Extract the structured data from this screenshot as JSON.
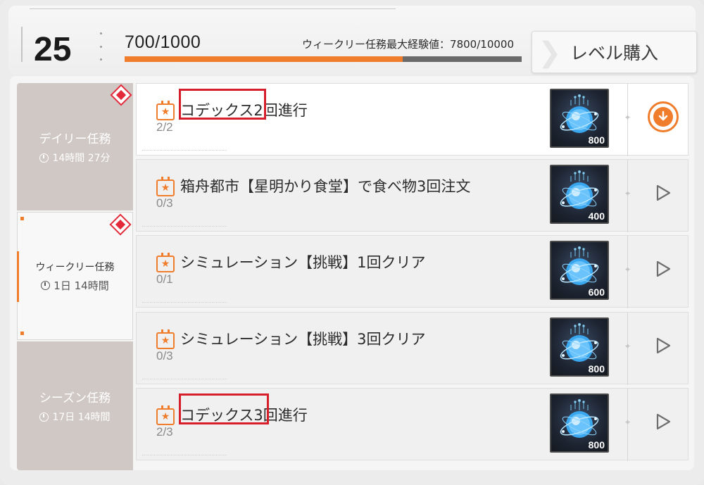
{
  "header": {
    "level": "25",
    "exp_current": "700/1000",
    "exp_fraction": 0.7,
    "weekly_cap_label": "ウィークリー任務最大経験値：7800/10000",
    "level_buy_label": "レベル購入"
  },
  "tabs": [
    {
      "title": "デイリー任務",
      "time": "14時間 27分",
      "active": false,
      "badge": true
    },
    {
      "title": "ウィークリー任務",
      "time": "1日 14時間",
      "active": true,
      "badge": true
    },
    {
      "title": "シーズン任務",
      "time": "17日 14時間",
      "active": false,
      "badge": false
    }
  ],
  "missions": [
    {
      "title": "コデックス2回進行",
      "progress": "2/2",
      "reward_qty": "800",
      "action": "claim",
      "done": true,
      "highlight": true
    },
    {
      "title": "箱舟都市【星明かり食堂】で食べ物3回注文",
      "progress": "0/3",
      "reward_qty": "400",
      "action": "go",
      "done": false,
      "highlight": false
    },
    {
      "title": "シミュレーション【挑戦】1回クリア",
      "progress": "0/1",
      "reward_qty": "600",
      "action": "go",
      "done": false,
      "highlight": false
    },
    {
      "title": "シミュレーション【挑戦】3回クリア",
      "progress": "0/3",
      "reward_qty": "800",
      "action": "go",
      "done": false,
      "highlight": false
    },
    {
      "title": "コデックス3回進行",
      "progress": "2/3",
      "reward_qty": "800",
      "action": "go",
      "done": false,
      "highlight": true
    }
  ],
  "colors": {
    "accent": "#ef7d2c",
    "highlight_box": "#d61f2b",
    "badge": "#e22a3b",
    "inactive_tab": "#cfc8c4"
  },
  "icons": {
    "mission": "calendar-star-icon",
    "reward": "experience-orb-icon",
    "claim": "claim-download-icon",
    "go": "play-arrow-icon",
    "time": "clock-icon"
  }
}
